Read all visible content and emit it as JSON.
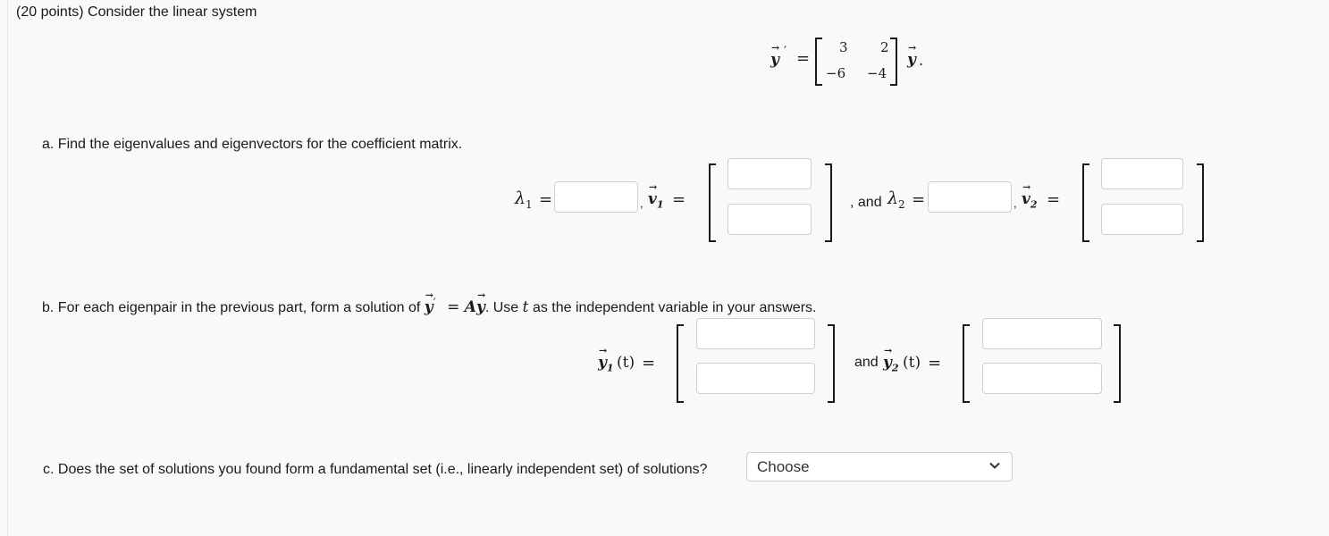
{
  "header": {
    "points_label": "(20 points) Consider the linear system"
  },
  "system": {
    "lhs": "y",
    "prime": "′",
    "equals": "=",
    "matrix": [
      [
        "3",
        "2"
      ],
      [
        "−6",
        "−4"
      ]
    ],
    "rhs": "y",
    "period": "."
  },
  "part_a": {
    "prompt": "a. Find the eigenvalues and eigenvectors for the coefficient matrix.",
    "lambda1_label": "λ",
    "lambda1_sub": "1",
    "v1_label": "v",
    "v1_sub": "1",
    "and_text": ", and",
    "lambda2_label": "λ",
    "lambda2_sub": "2",
    "v2_label": "v",
    "v2_sub": "2",
    "comma": ",",
    "equals": "=",
    "lambda1_value": "",
    "lambda2_value": "",
    "v1_values": [
      "",
      ""
    ],
    "v2_values": [
      "",
      ""
    ]
  },
  "part_b": {
    "prompt_start": "b. For each eigenpair in the previous part, form a solution of",
    "prompt_eq": "= ",
    "prompt_A": "A",
    "prompt_mid": ". Use",
    "prompt_t": "t",
    "prompt_end": "as the independent variable in your answers.",
    "y1_label": "y",
    "y1_sub": "1",
    "t_arg": "(t)",
    "and_text": "and",
    "y2_label": "y",
    "y2_sub": "2",
    "equals": "=",
    "y1_values": [
      "",
      ""
    ],
    "y2_values": [
      "",
      ""
    ]
  },
  "part_c": {
    "prompt": "c. Does the set of solutions you found form a fundamental set (i.e., linearly independent set) of solutions?",
    "select_value": "Choose",
    "chevron_icon": "chevron-down-icon"
  }
}
